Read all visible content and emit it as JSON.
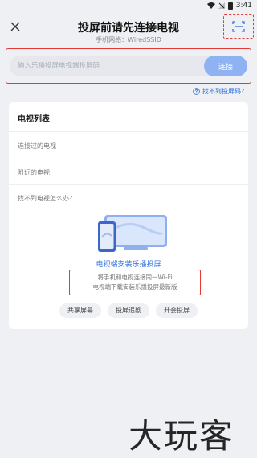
{
  "status_bar": {
    "time": "3:41"
  },
  "header": {
    "title": "投屏前请先连接电视",
    "subtitle": "手机网络：WiredSSID"
  },
  "input": {
    "placeholder": "输入乐播投屏电视端投屏码",
    "value": "",
    "connect_label": "连接"
  },
  "help_link": "找不到投屏码？",
  "tv_list": {
    "title": "电视列表",
    "connected_label": "连接过的电视",
    "nearby_label": "附近的电视",
    "not_found_label": "找不到电视怎么办？",
    "install_link": "电视端安装乐播投屏",
    "tip_line1": "将手机和电视连接同一Wi-Fi",
    "tip_line2": "电视端下载安装乐播投屏最新版",
    "chips": [
      "共享屏幕",
      "投屏追剧",
      "开会投屏"
    ]
  },
  "watermark": "大玩客",
  "colors": {
    "accent_blue": "#2f6fe0",
    "connect_button": "#8fb2f2",
    "highlight_red": "#e53935",
    "background": "#eef0f4"
  }
}
